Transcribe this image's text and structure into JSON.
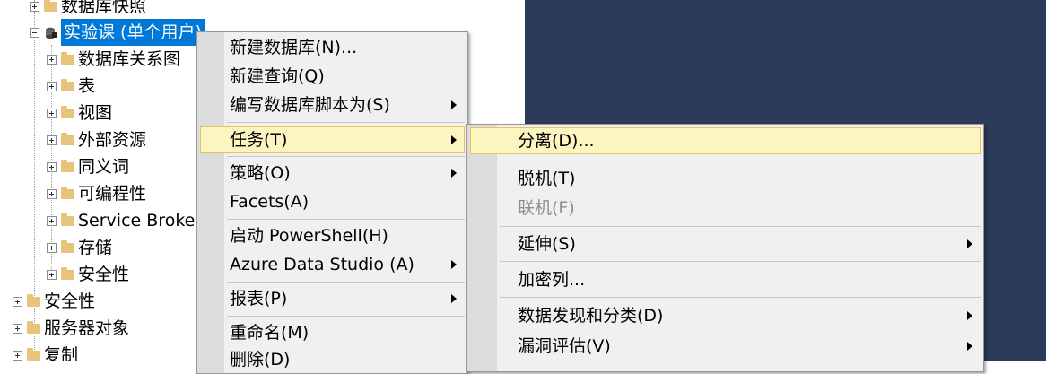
{
  "tree": {
    "items": [
      {
        "label": "数据库快照",
        "expander": "plus"
      },
      {
        "label": "实验课 (单个用户)",
        "expander": "minus"
      },
      {
        "label": "数据库关系图",
        "expander": "plus"
      },
      {
        "label": "表",
        "expander": "plus"
      },
      {
        "label": "视图",
        "expander": "plus"
      },
      {
        "label": "外部资源",
        "expander": "plus"
      },
      {
        "label": "同义词",
        "expander": "plus"
      },
      {
        "label": "可编程性",
        "expander": "plus"
      },
      {
        "label": "Service Broker",
        "expander": "plus"
      },
      {
        "label": "存储",
        "expander": "plus"
      },
      {
        "label": "安全性",
        "expander": "plus"
      },
      {
        "label": "安全性",
        "expander": "plus"
      },
      {
        "label": "服务器对象",
        "expander": "plus"
      },
      {
        "label": "复制",
        "expander": "plus"
      }
    ]
  },
  "context_menu": {
    "items": [
      {
        "label": "新建数据库(N)..."
      },
      {
        "label": "新建查询(Q)"
      },
      {
        "label": "编写数据库脚本为(S)",
        "submenu": true
      },
      {
        "label": "任务(T)",
        "submenu": true,
        "highlighted": true
      },
      {
        "label": "策略(O)",
        "submenu": true
      },
      {
        "label": "Facets(A)"
      },
      {
        "label": "启动 PowerShell(H)"
      },
      {
        "label": "Azure Data Studio (A)",
        "submenu": true
      },
      {
        "label": "报表(P)",
        "submenu": true
      },
      {
        "label": "重命名(M)"
      },
      {
        "label": "删除(D)"
      }
    ]
  },
  "tasks_submenu": {
    "items": [
      {
        "label": "分离(D)...",
        "highlighted": true
      },
      {
        "label": "脱机(T)"
      },
      {
        "label": "联机(F)",
        "disabled": true
      },
      {
        "label": "延伸(S)",
        "submenu": true
      },
      {
        "label": "加密列..."
      },
      {
        "label": "数据发现和分类(D)",
        "submenu": true
      },
      {
        "label": "漏洞评估(V)",
        "submenu": true
      }
    ]
  },
  "colors": {
    "selection": "#0078d7",
    "menu_highlight": "#fcf5c0",
    "menu_highlight_border": "#e5c365",
    "background_panel": "#2d3b5a",
    "folder": "#e8c47a"
  }
}
